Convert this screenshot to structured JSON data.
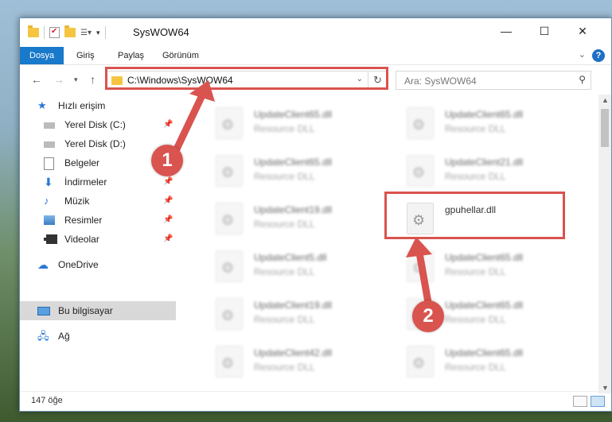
{
  "window": {
    "title": "SysWOW64"
  },
  "ribbon": {
    "tabs": [
      "Dosya",
      "Giriş",
      "Paylaş",
      "Görünüm"
    ]
  },
  "address": {
    "path": "C:\\Windows\\SysWOW64"
  },
  "search": {
    "placeholder": "Ara: SysWOW64"
  },
  "sidebar": {
    "items": [
      {
        "label": "Hızlı erişim",
        "icon": "star-icon"
      },
      {
        "label": "Yerel Disk (C:)",
        "icon": "drive-icon",
        "pinned": true
      },
      {
        "label": "Yerel Disk (D:)",
        "icon": "drive-icon",
        "pinned": false
      },
      {
        "label": "Belgeler",
        "icon": "document-icon",
        "pinned": false
      },
      {
        "label": "İndirmeler",
        "icon": "download-icon",
        "pinned": true
      },
      {
        "label": "Müzik",
        "icon": "music-icon",
        "pinned": true
      },
      {
        "label": "Resimler",
        "icon": "picture-icon",
        "pinned": true
      },
      {
        "label": "Videolar",
        "icon": "video-icon",
        "pinned": true
      },
      {
        "label": "OneDrive",
        "icon": "cloud-icon"
      },
      {
        "label": "Bu bilgisayar",
        "icon": "computer-icon",
        "selected": true
      },
      {
        "label": "Ağ",
        "icon": "network-icon"
      }
    ]
  },
  "files": [
    {
      "name": "UpdateClient65.dll",
      "desc": "Resource DLL"
    },
    {
      "name": "UpdateClient65.dll",
      "desc": "Resource DLL"
    },
    {
      "name": "UpdateClient65.dll",
      "desc": "Resource DLL"
    },
    {
      "name": "UpdateClient21.dll",
      "desc": "Resource DLL"
    },
    {
      "name": "UpdateClient19.dll",
      "desc": "Resource DLL"
    },
    {
      "name": "gpuhellar.dll",
      "desc": ""
    },
    {
      "name": "UpdateClient5.dll",
      "desc": "Resource DLL"
    },
    {
      "name": "UpdateClient65.dll",
      "desc": "Resource DLL"
    },
    {
      "name": "UpdateClient19.dll",
      "desc": "Resource DLL"
    },
    {
      "name": "UpdateClient65.dll",
      "desc": "Resource DLL"
    },
    {
      "name": "UpdateClient42.dll",
      "desc": "Resource DLL"
    },
    {
      "name": "UpdateClient65.dll",
      "desc": "Resource DLL"
    }
  ],
  "status": {
    "count": "147 öğe"
  },
  "annotations": {
    "badge1": "1",
    "badge2": "2",
    "color": "#d9534f"
  }
}
